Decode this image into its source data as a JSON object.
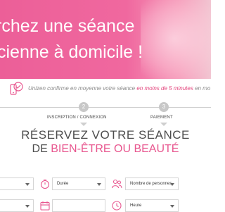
{
  "hero": {
    "line1": "rchez une séance",
    "line2": "cienne à domicile !"
  },
  "promo": {
    "prefix": "Unizen confirme en moyenne votre séance",
    "highlight": "en moins de 5 minutes",
    "suffix": "en mo"
  },
  "steps": [
    {
      "number": "2",
      "label": "INSCRIPTION / CONNEXION"
    },
    {
      "number": "3",
      "label": "PAIEMENT"
    }
  ],
  "booking": {
    "title": "RÉSERVEZ VOTRE SÉANCE",
    "subtitle_prefix": "DE",
    "subtitle_highlight": "BIEN-ÊTRE OU BEAUTÉ"
  },
  "fields": {
    "duration_label": "Durée",
    "persons_label": "Nombre de personnes",
    "hour_label": "Heure"
  },
  "colors": {
    "brand_pink": "#ec5f98",
    "accent_pink": "#e3447c"
  }
}
